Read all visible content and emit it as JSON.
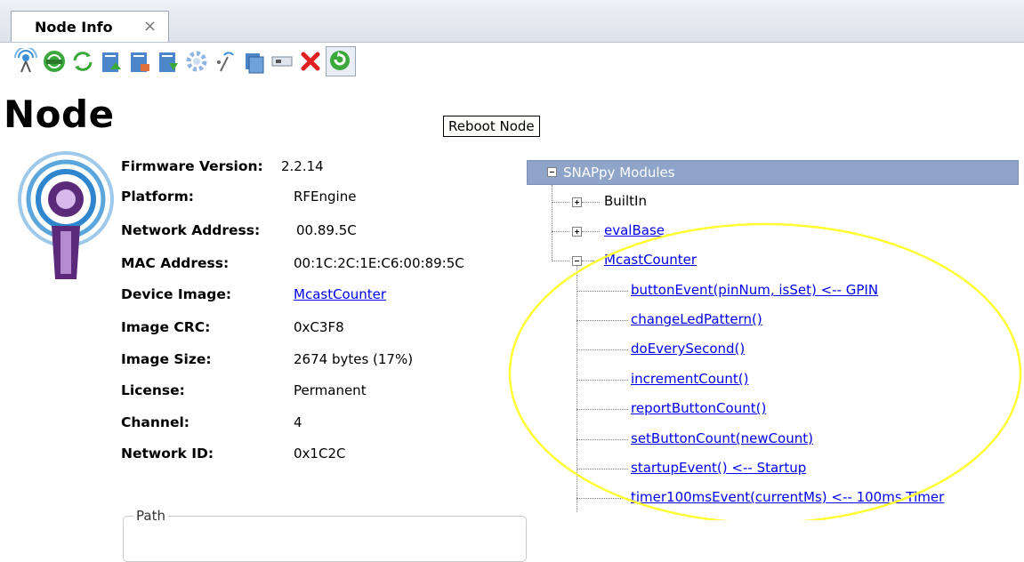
{
  "tab": {
    "label": "Node Info",
    "close": "×"
  },
  "toolbar": {
    "icons": [
      "ping-icon",
      "broadcast-icon",
      "refresh-icon",
      "upload-script-icon",
      "erase-script-icon",
      "download-script-icon",
      "settings-gear-icon",
      "radio-link-icon",
      "clipboard-icon",
      "console-icon",
      "delete-icon",
      "reboot-icon"
    ]
  },
  "tooltip": "Reboot Node",
  "title": "Node",
  "info": {
    "firmware_label": "Firmware Version:",
    "firmware_value": "2.2.14",
    "platform_label": "Platform:",
    "platform_value": "RFEngine",
    "net_addr_label": "Network Address:",
    "net_addr_value": "00.89.5C",
    "mac_label": "MAC Address:",
    "mac_value": "00:1C:2C:1E:C6:00:89:5C",
    "device_image_label": "Device Image:",
    "device_image_value": "McastCounter",
    "crc_label": "Image CRC:",
    "crc_value": "0xC3F8",
    "size_label": "Image Size:",
    "size_value": "2674 bytes (17%)",
    "license_label": "License:",
    "license_value": "Permanent",
    "channel_label": "Channel:",
    "channel_value": "4",
    "network_id_label": "Network ID:",
    "network_id_value": "0x1C2C",
    "path_label": "Path"
  },
  "tree": {
    "root": "SNAPpy Modules",
    "modules": [
      "BuiltIn",
      "evalBase",
      "McastCounter"
    ],
    "functions": [
      "buttonEvent(pinNum, isSet) <-- GPIN",
      "changeLedPattern()",
      "doEverySecond()",
      "incrementCount()",
      "reportButtonCount()",
      "setButtonCount(newCount)",
      "startupEvent() <-- Startup",
      "timer100msEvent(currentMs) <-- 100ms Timer"
    ]
  },
  "colors": {
    "tree_root_bg": "#8ea4c8",
    "link": "#0000ee",
    "highlight": "#ffff33"
  }
}
